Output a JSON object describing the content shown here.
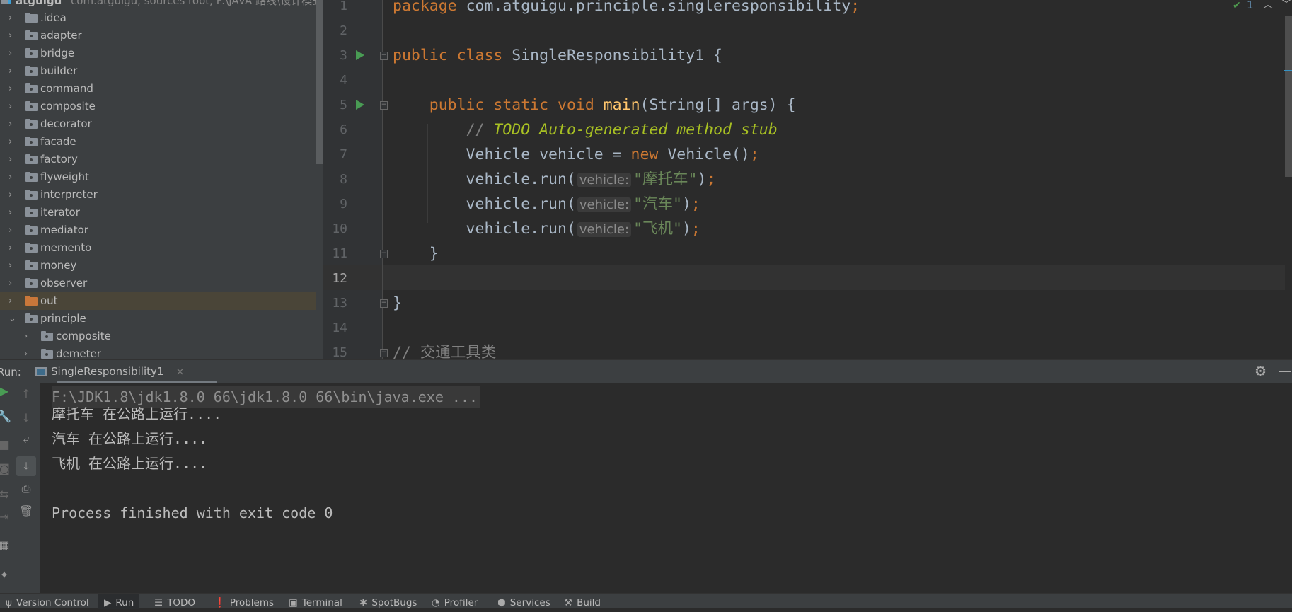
{
  "project": {
    "root_name": "atguigu",
    "root_hint": "com.atguigu, sources root, F:\\JAVA 路线\\设计模式",
    "items": [
      {
        "label": ".idea",
        "type": "folder",
        "level": 0,
        "expanded": false
      },
      {
        "label": "adapter",
        "type": "package",
        "level": 0,
        "expanded": false
      },
      {
        "label": "bridge",
        "type": "package",
        "level": 0,
        "expanded": false
      },
      {
        "label": "builder",
        "type": "package",
        "level": 0,
        "expanded": false
      },
      {
        "label": "command",
        "type": "package",
        "level": 0,
        "expanded": false
      },
      {
        "label": "composite",
        "type": "package",
        "level": 0,
        "expanded": false
      },
      {
        "label": "decorator",
        "type": "package",
        "level": 0,
        "expanded": false
      },
      {
        "label": "facade",
        "type": "package",
        "level": 0,
        "expanded": false
      },
      {
        "label": "factory",
        "type": "package",
        "level": 0,
        "expanded": false
      },
      {
        "label": "flyweight",
        "type": "package",
        "level": 0,
        "expanded": false
      },
      {
        "label": "interpreter",
        "type": "package",
        "level": 0,
        "expanded": false
      },
      {
        "label": "iterator",
        "type": "package",
        "level": 0,
        "expanded": false
      },
      {
        "label": "mediator",
        "type": "package",
        "level": 0,
        "expanded": false
      },
      {
        "label": "memento",
        "type": "package",
        "level": 0,
        "expanded": false
      },
      {
        "label": "money",
        "type": "package",
        "level": 0,
        "expanded": false
      },
      {
        "label": "observer",
        "type": "package",
        "level": 0,
        "expanded": false
      },
      {
        "label": "out",
        "type": "excluded",
        "level": 0,
        "expanded": false,
        "selected": true
      },
      {
        "label": "principle",
        "type": "package",
        "level": 0,
        "expanded": true
      },
      {
        "label": "composite",
        "type": "package",
        "level": 1,
        "expanded": false
      },
      {
        "label": "demeter",
        "type": "package",
        "level": 1,
        "expanded": false
      }
    ]
  },
  "editor": {
    "current_line": 12,
    "inspection_count": "1",
    "lines": [
      {
        "n": "1",
        "tokens": [
          [
            "k",
            "package "
          ],
          [
            "",
            "com.atguigu.principle.singleresponsibility"
          ],
          [
            "k",
            ";"
          ]
        ]
      },
      {
        "n": "2",
        "tokens": []
      },
      {
        "n": "3",
        "run": true,
        "fold": true,
        "tokens": [
          [
            "k",
            "public class "
          ],
          [
            "",
            "SingleResponsibility1 {"
          ]
        ]
      },
      {
        "n": "4",
        "tokens": []
      },
      {
        "n": "5",
        "run": true,
        "fold": true,
        "tokens": [
          [
            "",
            "    "
          ],
          [
            "k",
            "public static void "
          ],
          [
            "m",
            "main"
          ],
          [
            "",
            "(String[] args) {"
          ]
        ]
      },
      {
        "n": "6",
        "tokens": [
          [
            "",
            "        "
          ],
          [
            "c",
            "// "
          ],
          [
            "t",
            "TODO Auto-generated method stub"
          ]
        ]
      },
      {
        "n": "7",
        "tokens": [
          [
            "",
            "        Vehicle vehicle = "
          ],
          [
            "k",
            "new "
          ],
          [
            "",
            "Vehicle()"
          ],
          [
            "k",
            ";"
          ]
        ]
      },
      {
        "n": "8",
        "tokens": [
          [
            "",
            "        vehicle.run("
          ],
          [
            "hint",
            "vehicle:"
          ],
          [
            "s",
            "\"摩托车\""
          ],
          [
            "",
            ")"
          ],
          [
            "k",
            ";"
          ]
        ]
      },
      {
        "n": "9",
        "tokens": [
          [
            "",
            "        vehicle.run("
          ],
          [
            "hint",
            "vehicle:"
          ],
          [
            "s",
            "\"汽车\""
          ],
          [
            "",
            ")"
          ],
          [
            "k",
            ";"
          ]
        ]
      },
      {
        "n": "10",
        "tokens": [
          [
            "",
            "        vehicle.run("
          ],
          [
            "hint",
            "vehicle:"
          ],
          [
            "s",
            "\"飞机\""
          ],
          [
            "",
            ")"
          ],
          [
            "k",
            ";"
          ]
        ]
      },
      {
        "n": "11",
        "fold": true,
        "tokens": [
          [
            "",
            "    }"
          ]
        ]
      },
      {
        "n": "12",
        "tokens": []
      },
      {
        "n": "13",
        "fold": true,
        "tokens": [
          [
            "",
            "}"
          ]
        ]
      },
      {
        "n": "14",
        "tokens": []
      },
      {
        "n": "15",
        "fold": true,
        "tokens": [
          [
            "c",
            "// 交通工具类"
          ]
        ]
      }
    ]
  },
  "run_panel": {
    "label": "Run:",
    "tab": "SingleResponsibility1",
    "close": "×",
    "output": [
      "F:\\JDK1.8\\jdk1.8.0_66\\jdk1.8.0_66\\bin\\java.exe ...",
      "摩托车 在公路上运行....",
      "汽车 在公路上运行....",
      "飞机 在公路上运行....",
      "",
      "Process finished with exit code 0"
    ]
  },
  "bottom_tabs": [
    {
      "label": "Version Control",
      "icon": "branch-icon",
      "glyph": "ψ"
    },
    {
      "label": "Run",
      "icon": "run-icon",
      "glyph": "▶",
      "active": true
    },
    {
      "label": "TODO",
      "icon": "list-icon",
      "glyph": "☰"
    },
    {
      "label": "Problems",
      "icon": "problems-icon",
      "glyph": "❗"
    },
    {
      "label": "Terminal",
      "icon": "terminal-icon",
      "glyph": "▣"
    },
    {
      "label": "SpotBugs",
      "icon": "bug-icon",
      "glyph": "✱"
    },
    {
      "label": "Profiler",
      "icon": "profiler-icon",
      "glyph": "◔"
    },
    {
      "label": "Services",
      "icon": "services-icon",
      "glyph": "⬢"
    },
    {
      "label": "Build",
      "icon": "hammer-icon",
      "glyph": "⚒"
    }
  ],
  "colors": {
    "editor_bg": "#2b2b2b",
    "keyword": "#cc7832",
    "string": "#6a8759",
    "todo": "#a8c023",
    "method": "#ffc66d",
    "run_green": "#499c54"
  }
}
